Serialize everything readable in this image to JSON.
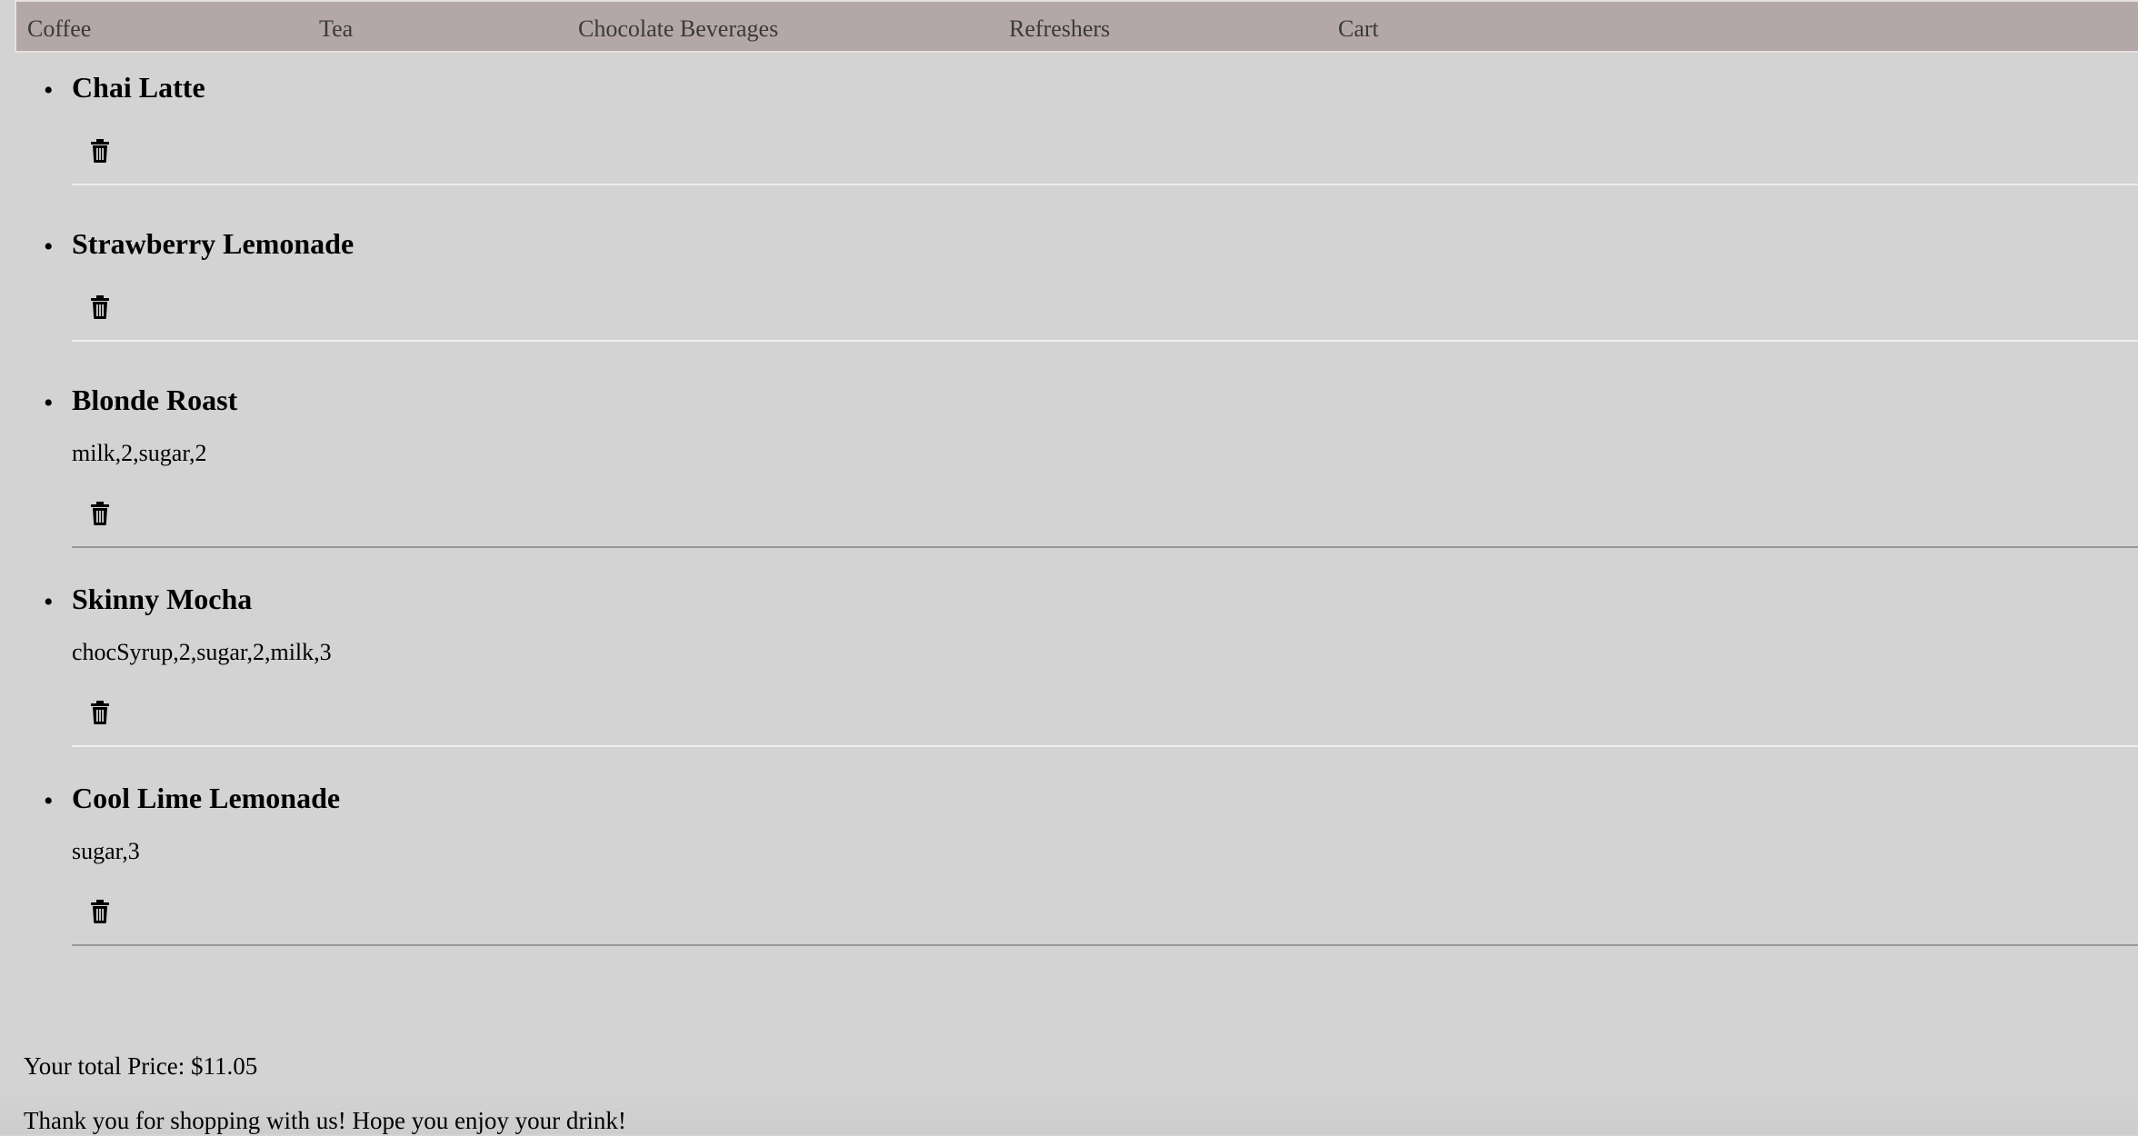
{
  "nav": {
    "items": [
      {
        "label": "Coffee"
      },
      {
        "label": "Tea"
      },
      {
        "label": "Chocolate Beverages"
      },
      {
        "label": "Refreshers"
      },
      {
        "label": "Cart"
      }
    ]
  },
  "cart": {
    "items": [
      {
        "name": "Chai Latte",
        "options": "",
        "delete_icon": "trash-icon"
      },
      {
        "name": "Strawberry Lemonade",
        "options": "",
        "delete_icon": "trash-icon"
      },
      {
        "name": "Blonde Roast",
        "options": "milk,2,sugar,2",
        "delete_icon": "trash-icon"
      },
      {
        "name": "Skinny Mocha",
        "options": "chocSyrup,2,sugar,2,milk,3",
        "delete_icon": "trash-icon"
      },
      {
        "name": "Cool Lime Lemonade",
        "options": "sugar,3",
        "delete_icon": "trash-icon"
      }
    ]
  },
  "footer": {
    "total_text": "Your total Price: $11.05",
    "thanks_text": "Thank you for shopping with us! Hope you enjoy your drink!"
  },
  "colors": {
    "background": "#d3d3d3",
    "navbar": "#b3a8a7",
    "nav_text": "#3a3a3a"
  }
}
